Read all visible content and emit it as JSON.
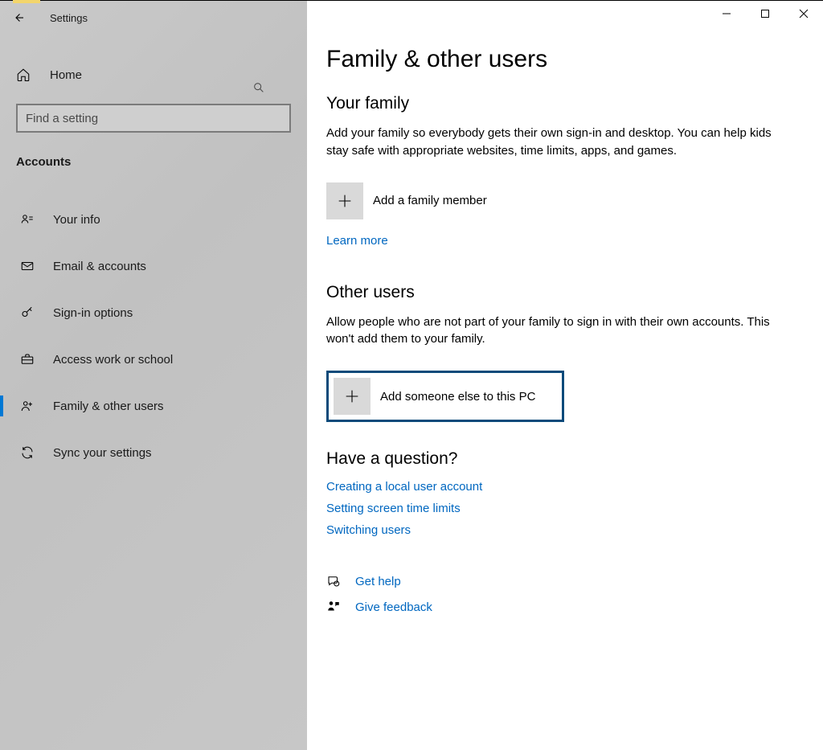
{
  "window": {
    "title": "Settings"
  },
  "sidebar": {
    "home_label": "Home",
    "search_placeholder": "Find a setting",
    "section_label": "Accounts",
    "items": [
      {
        "icon": "user-card-icon",
        "label": "Your info"
      },
      {
        "icon": "envelope-icon",
        "label": "Email & accounts"
      },
      {
        "icon": "key-icon",
        "label": "Sign-in options"
      },
      {
        "icon": "briefcase-icon",
        "label": "Access work or school"
      },
      {
        "icon": "family-icon",
        "label": "Family & other users"
      },
      {
        "icon": "sync-icon",
        "label": "Sync your settings"
      }
    ],
    "active_index": 4
  },
  "page": {
    "title": "Family & other users",
    "family": {
      "heading": "Your family",
      "description": "Add your family so everybody gets their own sign-in and desktop. You can help kids stay safe with appropriate websites, time limits, apps, and games.",
      "add_label": "Add a family member",
      "learn_more": "Learn more"
    },
    "other": {
      "heading": "Other users",
      "description": "Allow people who are not part of your family to sign in with their own accounts. This won't add them to your family.",
      "add_label": "Add someone else to this PC"
    },
    "question": {
      "heading": "Have a question?",
      "links": [
        "Creating a local user account",
        "Setting screen time limits",
        "Switching users"
      ]
    },
    "footer": {
      "get_help": "Get help",
      "give_feedback": "Give feedback"
    }
  }
}
